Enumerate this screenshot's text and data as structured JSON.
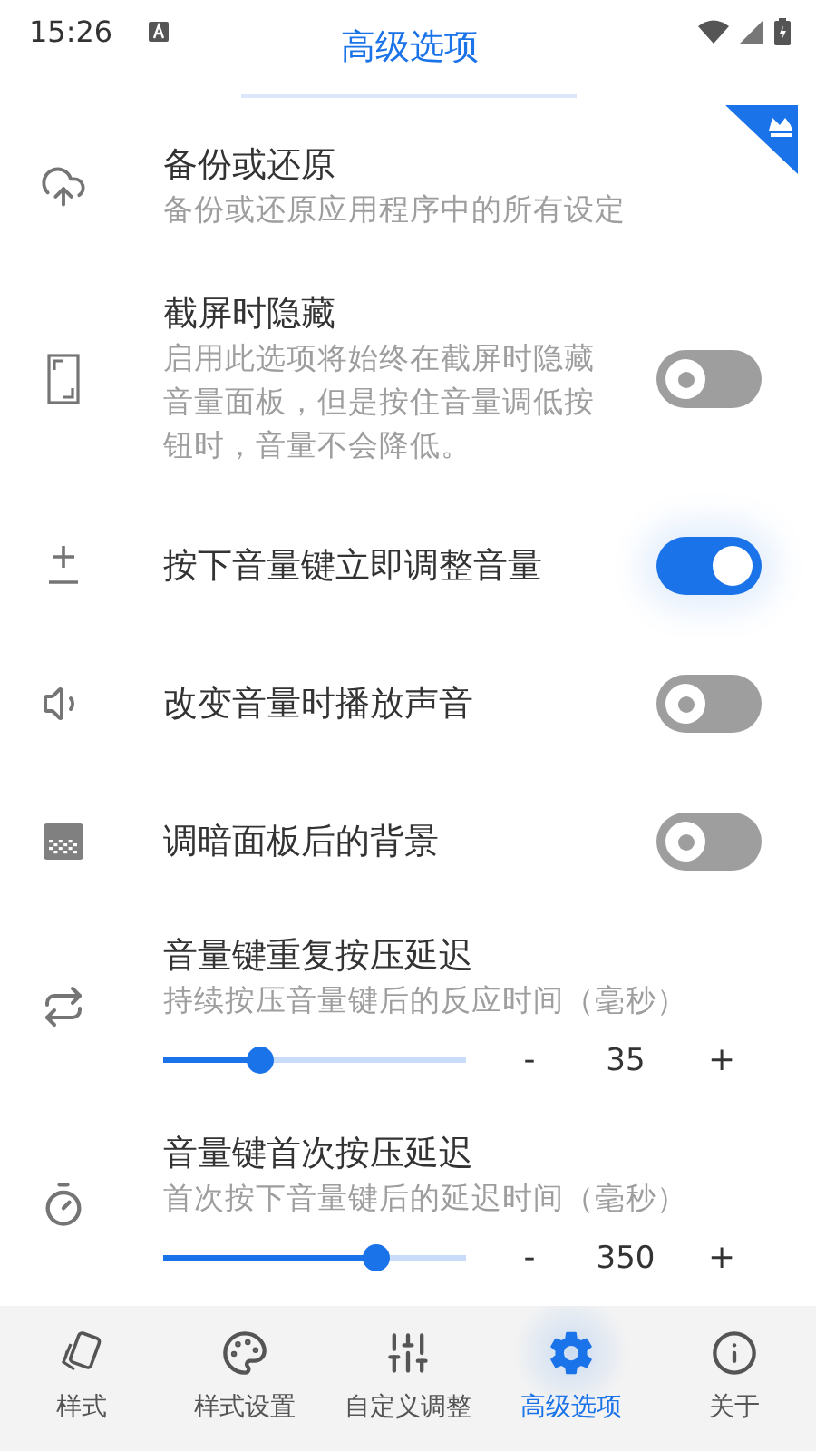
{
  "status_bar": {
    "time": "15:26"
  },
  "header": {
    "title": "高级选项"
  },
  "settings": [
    {
      "kind": "link",
      "title": "备份或还原",
      "subtitle": "备份或还原应用程序中的所有设定",
      "premium": true
    },
    {
      "kind": "toggle",
      "title": "截屏时隐藏",
      "subtitle": "启用此选项将始终在截屏时隐藏音量面板，但是按住音量调低按钮时，音量不会降低。",
      "on": false
    },
    {
      "kind": "toggle",
      "title": "按下音量键立即调整音量",
      "on": true
    },
    {
      "kind": "toggle",
      "title": "改变音量时播放声音",
      "on": false
    },
    {
      "kind": "toggle",
      "title": "调暗面板后的背景",
      "on": false
    },
    {
      "kind": "slider",
      "title": "音量键重复按压延迟",
      "subtitle": "持续按压音量键后的反应时间（毫秒）",
      "level": 0.32,
      "minus": "-",
      "value": "35",
      "plus": "+"
    },
    {
      "kind": "slider",
      "title": "音量键首次按压延迟",
      "subtitle": "首次按下音量键后的延迟时间（毫秒）",
      "level": 0.7,
      "minus": "-",
      "value": "350",
      "plus": "+"
    }
  ],
  "nav": [
    {
      "label": "样式",
      "selected": false
    },
    {
      "label": "样式设置",
      "selected": false
    },
    {
      "label": "自定义调整",
      "selected": false
    },
    {
      "label": "高级选项",
      "selected": true
    },
    {
      "label": "关于",
      "selected": false
    }
  ]
}
